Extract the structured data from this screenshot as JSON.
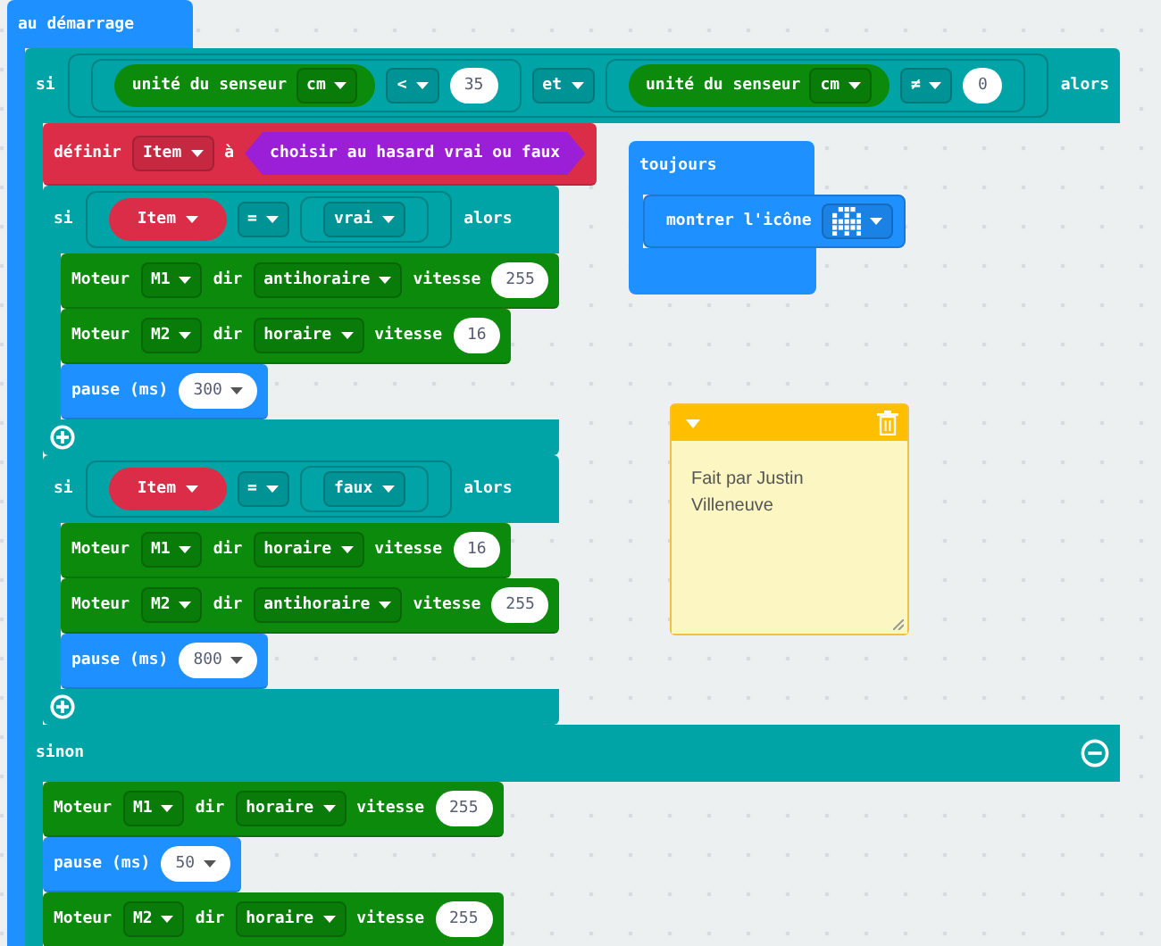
{
  "workspace": {
    "blocks": [
      {
        "kind": "event",
        "color": "#1e90ff",
        "label": "au démarrage",
        "body": [
          {
            "kind": "if",
            "color": "#00a4a6",
            "branches": [
              {
                "parts": [
                  {
                    "kind": "label",
                    "text": "si"
                  },
                  {
                    "kind": "condition",
                    "color": "#00a4a6",
                    "parts": [
                      {
                        "kind": "condition",
                        "color": "#00a4a6",
                        "parts": [
                          {
                            "kind": "reporter",
                            "color": "#0b8a0b",
                            "parts": [
                              {
                                "kind": "label",
                                "text": "unité du senseur"
                              },
                              {
                                "kind": "dropdown",
                                "text": "cm"
                              }
                            ]
                          },
                          {
                            "kind": "dropdown",
                            "text": "<"
                          },
                          {
                            "kind": "number",
                            "text": "35"
                          }
                        ]
                      },
                      {
                        "kind": "dropdown",
                        "text": "et"
                      },
                      {
                        "kind": "condition",
                        "color": "#00a4a6",
                        "parts": [
                          {
                            "kind": "reporter",
                            "color": "#0b8a0b",
                            "parts": [
                              {
                                "kind": "label",
                                "text": "unité du senseur"
                              },
                              {
                                "kind": "dropdown",
                                "text": "cm"
                              }
                            ]
                          },
                          {
                            "kind": "dropdown",
                            "text": "≠"
                          },
                          {
                            "kind": "number",
                            "text": "0"
                          }
                        ]
                      }
                    ]
                  },
                  {
                    "kind": "label",
                    "text": "alors"
                  }
                ],
                "body": [
                  {
                    "kind": "statement",
                    "color": "#dc2d48",
                    "parts": [
                      {
                        "kind": "label",
                        "text": "définir"
                      },
                      {
                        "kind": "dropdown",
                        "text": "Item"
                      },
                      {
                        "kind": "label",
                        "text": "à"
                      },
                      {
                        "kind": "boolean",
                        "color": "#9a1fd6",
                        "parts": [
                          {
                            "kind": "label",
                            "text": "choisir au hasard vrai ou faux"
                          }
                        ]
                      }
                    ]
                  },
                  {
                    "kind": "if",
                    "color": "#00a4a6",
                    "branches": [
                      {
                        "parts": [
                          {
                            "kind": "label",
                            "text": "si"
                          },
                          {
                            "kind": "condition",
                            "color": "#00a4a6",
                            "parts": [
                              {
                                "kind": "reporter",
                                "color": "#dc2d48",
                                "parts": [
                                  {
                                    "kind": "variable_dropdown",
                                    "text": "Item"
                                  }
                                ]
                              },
                              {
                                "kind": "dropdown",
                                "text": "="
                              },
                              {
                                "kind": "condition",
                                "color": "#00a4a6",
                                "parts": [
                                  {
                                    "kind": "dropdown",
                                    "text": "vrai"
                                  }
                                ]
                              }
                            ]
                          },
                          {
                            "kind": "label",
                            "text": "alors"
                          }
                        ],
                        "body": [
                          {
                            "kind": "statement",
                            "color": "#0b8a0b",
                            "parts": [
                              {
                                "kind": "label",
                                "text": "Moteur"
                              },
                              {
                                "kind": "dropdown",
                                "text": "M1"
                              },
                              {
                                "kind": "label",
                                "text": "dir"
                              },
                              {
                                "kind": "dropdown",
                                "text": "antihoraire"
                              },
                              {
                                "kind": "label",
                                "text": "vitesse"
                              },
                              {
                                "kind": "number",
                                "text": "255"
                              }
                            ]
                          },
                          {
                            "kind": "statement",
                            "color": "#0b8a0b",
                            "parts": [
                              {
                                "kind": "label",
                                "text": "Moteur"
                              },
                              {
                                "kind": "dropdown",
                                "text": "M2"
                              },
                              {
                                "kind": "label",
                                "text": "dir"
                              },
                              {
                                "kind": "dropdown",
                                "text": "horaire"
                              },
                              {
                                "kind": "label",
                                "text": "vitesse"
                              },
                              {
                                "kind": "number",
                                "text": "16"
                              }
                            ]
                          },
                          {
                            "kind": "statement",
                            "color": "#1e90ff",
                            "parts": [
                              {
                                "kind": "label",
                                "text": "pause (ms)"
                              },
                              {
                                "kind": "number_dropdown",
                                "text": "300"
                              }
                            ]
                          }
                        ]
                      }
                    ]
                  },
                  {
                    "kind": "if",
                    "color": "#00a4a6",
                    "branches": [
                      {
                        "parts": [
                          {
                            "kind": "label",
                            "text": "si"
                          },
                          {
                            "kind": "condition",
                            "color": "#00a4a6",
                            "parts": [
                              {
                                "kind": "reporter",
                                "color": "#dc2d48",
                                "parts": [
                                  {
                                    "kind": "variable_dropdown",
                                    "text": "Item"
                                  }
                                ]
                              },
                              {
                                "kind": "dropdown",
                                "text": "="
                              },
                              {
                                "kind": "condition",
                                "color": "#00a4a6",
                                "parts": [
                                  {
                                    "kind": "dropdown",
                                    "text": "faux"
                                  }
                                ]
                              }
                            ]
                          },
                          {
                            "kind": "label",
                            "text": "alors"
                          }
                        ],
                        "body": [
                          {
                            "kind": "statement",
                            "color": "#0b8a0b",
                            "parts": [
                              {
                                "kind": "label",
                                "text": "Moteur"
                              },
                              {
                                "kind": "dropdown",
                                "text": "M1"
                              },
                              {
                                "kind": "label",
                                "text": "dir"
                              },
                              {
                                "kind": "dropdown",
                                "text": "horaire"
                              },
                              {
                                "kind": "label",
                                "text": "vitesse"
                              },
                              {
                                "kind": "number",
                                "text": "16"
                              }
                            ]
                          },
                          {
                            "kind": "statement",
                            "color": "#0b8a0b",
                            "parts": [
                              {
                                "kind": "label",
                                "text": "Moteur"
                              },
                              {
                                "kind": "dropdown",
                                "text": "M2"
                              },
                              {
                                "kind": "label",
                                "text": "dir"
                              },
                              {
                                "kind": "dropdown",
                                "text": "antihoraire"
                              },
                              {
                                "kind": "label",
                                "text": "vitesse"
                              },
                              {
                                "kind": "number",
                                "text": "255"
                              }
                            ]
                          },
                          {
                            "kind": "statement",
                            "color": "#1e90ff",
                            "parts": [
                              {
                                "kind": "label",
                                "text": "pause (ms)"
                              },
                              {
                                "kind": "number_dropdown",
                                "text": "800"
                              }
                            ]
                          }
                        ]
                      }
                    ]
                  }
                ]
              }
            ],
            "else": {
              "label": "sinon",
              "body": [
                {
                  "kind": "statement",
                  "color": "#0b8a0b",
                  "parts": [
                    {
                      "kind": "label",
                      "text": "Moteur"
                    },
                    {
                      "kind": "dropdown",
                      "text": "M1"
                    },
                    {
                      "kind": "label",
                      "text": "dir"
                    },
                    {
                      "kind": "dropdown",
                      "text": "horaire"
                    },
                    {
                      "kind": "label",
                      "text": "vitesse"
                    },
                    {
                      "kind": "number",
                      "text": "255"
                    }
                  ]
                },
                {
                  "kind": "statement",
                  "color": "#1e90ff",
                  "parts": [
                    {
                      "kind": "label",
                      "text": "pause (ms)"
                    },
                    {
                      "kind": "number_dropdown",
                      "text": "50"
                    }
                  ]
                },
                {
                  "kind": "statement",
                  "color": "#0b8a0b",
                  "parts": [
                    {
                      "kind": "label",
                      "text": "Moteur"
                    },
                    {
                      "kind": "dropdown",
                      "text": "M2"
                    },
                    {
                      "kind": "label",
                      "text": "dir"
                    },
                    {
                      "kind": "dropdown",
                      "text": "horaire"
                    },
                    {
                      "kind": "label",
                      "text": "vitesse"
                    },
                    {
                      "kind": "number",
                      "text": "255"
                    }
                  ]
                }
              ]
            }
          }
        ]
      },
      {
        "kind": "event",
        "color": "#1e90ff",
        "label": "toujours",
        "body": [
          {
            "kind": "statement",
            "color": "#1e90ff",
            "parts": [
              {
                "kind": "label",
                "text": "montrer l'icône"
              },
              {
                "kind": "icon_dropdown"
              }
            ]
          }
        ]
      }
    ],
    "comment": {
      "text": "Fait par Justin Villeneuve"
    }
  }
}
